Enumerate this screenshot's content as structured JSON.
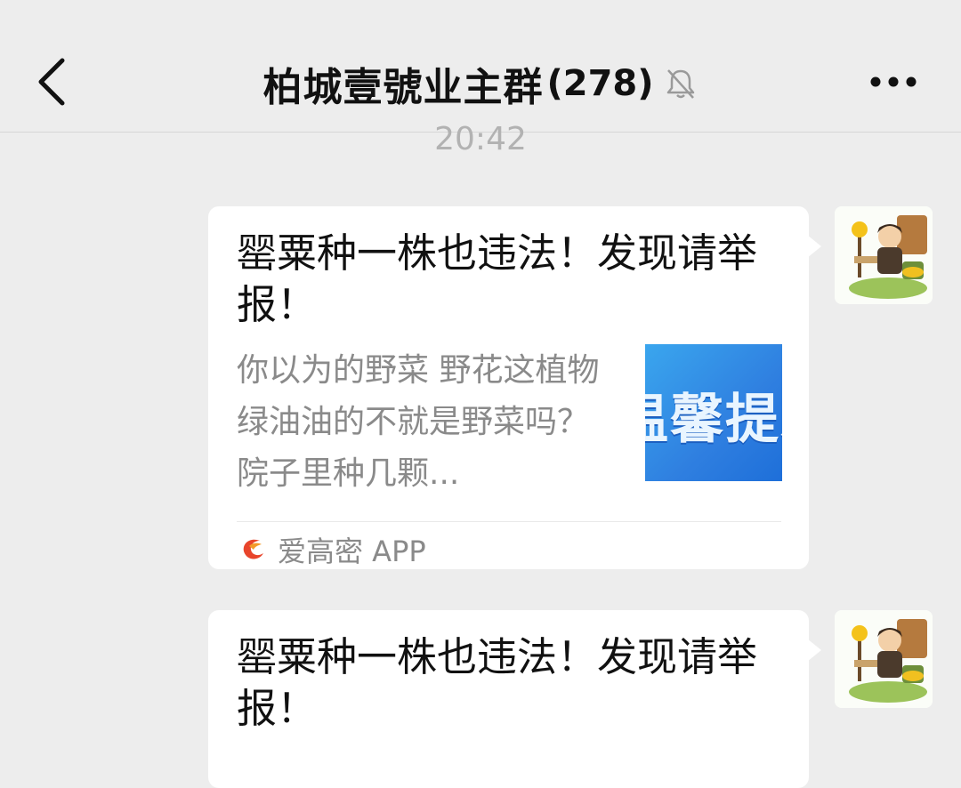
{
  "header": {
    "back_icon": "chevron-left-icon",
    "title": "柏城壹號业主群",
    "member_count": "(278)",
    "mute_icon": "bell-muted-icon",
    "more_icon": "more-dots-icon"
  },
  "timestamp": "20:42",
  "messages": [
    {
      "card_title": "罂粟种一株也违法！发现请举报！",
      "card_desc": "你以为的野菜 野花这植物绿油油的不就是野菜吗？院子里种几颗...",
      "thumb_text": "温馨提示",
      "source_label": "爱高密 APP",
      "source_icon": "app-logo-icon",
      "avatar": "cartoon-avatar"
    },
    {
      "card_title": "罂粟种一株也违法！发现请举报！",
      "avatar": "cartoon-avatar"
    }
  ],
  "colors": {
    "background": "#ededed",
    "bubble": "#ffffff",
    "title_text": "#111111",
    "secondary_text": "#8a8a8a",
    "timestamp": "#b2b2b2",
    "thumb_blue": "#2f7fe0"
  }
}
